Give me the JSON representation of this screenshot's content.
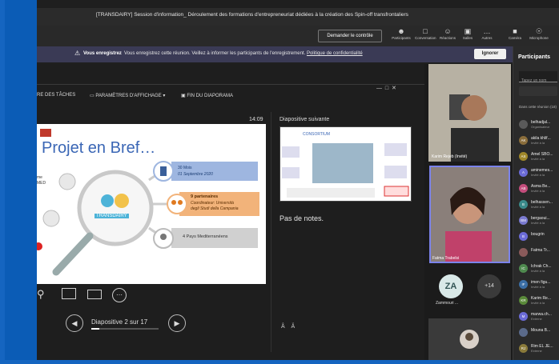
{
  "window": {
    "title": "[TRANSDAIRY] Session d'information_ Déroulement des formations d'entrepreneuriat dédiées à la création des Spin-off transfrontaliers"
  },
  "toolbar": {
    "control_button": "Demander le contrôle",
    "items": [
      {
        "label": "Participants",
        "icon": "people-icon"
      },
      {
        "label": "Conversation",
        "icon": "chat-icon"
      },
      {
        "label": "Réactions",
        "icon": "smile-icon"
      },
      {
        "label": "Salles",
        "icon": "rooms-icon"
      },
      {
        "label": "Autres",
        "icon": "more-icon"
      },
      {
        "label": "Caméra",
        "icon": "camera-icon"
      },
      {
        "label": "Microphone",
        "icon": "mic-icon"
      }
    ]
  },
  "notice": {
    "bold": "Vous enregistrez",
    "text": "Vous enregistrez cette réunion. Veillez à informer les participants de l'enregistrement.",
    "link": "Politique de confidentialité",
    "ignore": "Ignorer"
  },
  "ppt_toolbar": {
    "tasks": "RE DES TÂCHES",
    "display": "PARAMÈTRES D'AFFICHAGE ▾",
    "end": "FIN DU DIAPORAMA"
  },
  "slide": {
    "title": "Projet en Bref…",
    "box1_line1": "30 Mois",
    "box1_line2": "01 Septembre 2020",
    "box2_line1": "9 partenaires",
    "box2_line2": "Coordinateur: Università",
    "box2_line3": "degli Studi della Campania",
    "box3": "4 Pays Mediterranéens",
    "center_logo": "TRANSDAIRY",
    "left_label1": "me",
    "left_label2": "MED"
  },
  "presenter": {
    "time": "14:09",
    "next_label": "Diapositive suivante",
    "next_title": "CONSORTIUM",
    "notes": "Pas de notes.",
    "counter": "Diapositive 2 sur 17"
  },
  "videos": {
    "tile1_name": "Karim Rejeb (Invité)",
    "tile2_name": "Fatma Trabelsi",
    "avatar_initials": "ZA",
    "avatar_name": "Zammouri ...",
    "more_count": "+14"
  },
  "participants": {
    "title": "Participants",
    "search_placeholder": "Tapez un nom",
    "section": "Dans cette réunion (18)",
    "list": [
      {
        "initials": "",
        "name": "belhadjal...",
        "sub": "Organisateur",
        "color": "#5a5a5a"
      },
      {
        "initials": "AK",
        "name": "akila khlif...",
        "sub": "Invité à la",
        "color": "#8a6d3b"
      },
      {
        "initials": "AS",
        "name": "Amel SBO...",
        "sub": "Invité à la",
        "color": "#a0882a"
      },
      {
        "initials": "A",
        "name": "aminemes...",
        "sub": "Invité à la",
        "color": "#6b6bd6"
      },
      {
        "initials": "AB",
        "name": "Asma Be...",
        "sub": "Invité à la",
        "color": "#c44d7c"
      },
      {
        "initials": "B",
        "name": "belhassen...",
        "sub": "Invité à la",
        "color": "#3a8a8a"
      },
      {
        "initials": "BM",
        "name": "bergaoui...",
        "sub": "Invité à la",
        "color": "#7a7ad0"
      },
      {
        "initials": "B",
        "name": "bougrin",
        "sub": "",
        "color": "#6b6bd6"
      },
      {
        "initials": "",
        "name": "Fatma Tr...",
        "sub": "",
        "color": "#8a5a5a"
      },
      {
        "initials": "IC",
        "name": "Ichrak Ch...",
        "sub": "Invité à la",
        "color": "#4f8a4f"
      },
      {
        "initials": "IF",
        "name": "imen figu...",
        "sub": "Invité à la",
        "color": "#3a6ea5"
      },
      {
        "initials": "KR",
        "name": "Karim Re...",
        "sub": "Invité à la",
        "color": "#5a8a3a"
      },
      {
        "initials": "M",
        "name": "marwa.ch...",
        "sub": "Externe",
        "color": "#6b6bd6"
      },
      {
        "initials": "",
        "name": "Mouna B...",
        "sub": "",
        "color": "#5a6a8a"
      },
      {
        "initials": "RJ",
        "name": "Rim EL JE...",
        "sub": "Externe",
        "color": "#8a7a3a"
      }
    ]
  },
  "colors": {
    "accent": "#3a66b5",
    "notice_bg": "#3a3a55",
    "page_bg": "#1565c0"
  }
}
